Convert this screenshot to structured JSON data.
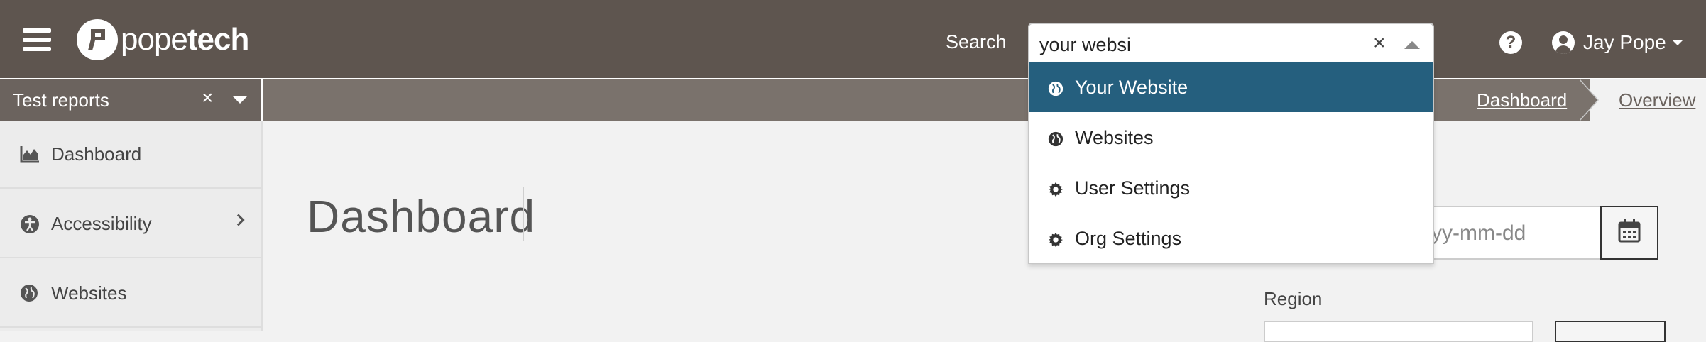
{
  "header": {
    "logo_text_regular": "pope",
    "logo_text_bold": "tech",
    "search_label": "Search",
    "search_value": "your websi",
    "user_name": "Jay Pope"
  },
  "subbar": {
    "test_reports_label": "Test reports",
    "breadcrumbs": [
      "Dashboard",
      "Overview"
    ]
  },
  "sidebar": {
    "items": [
      {
        "label": "Dashboard",
        "icon": "area-chart-icon"
      },
      {
        "label": "Accessibility",
        "icon": "accessibility-icon"
      },
      {
        "label": "Websites",
        "icon": "globe-icon"
      }
    ]
  },
  "main": {
    "title": "Dashboard",
    "date_placeholder": "yy-mm-dd",
    "region_label": "Region"
  },
  "search_dropdown": {
    "options": [
      {
        "label": "Your Website",
        "icon": "globe-icon",
        "selected": true
      },
      {
        "label": "Websites",
        "icon": "globe-icon",
        "selected": false
      },
      {
        "label": "User Settings",
        "icon": "gear-icon",
        "selected": false
      },
      {
        "label": "Org Settings",
        "icon": "gear-icon",
        "selected": false
      }
    ]
  },
  "colors": {
    "topbar": "#5e554f",
    "subbar": "#7a726c",
    "dropdown_active": "#255f7e"
  }
}
